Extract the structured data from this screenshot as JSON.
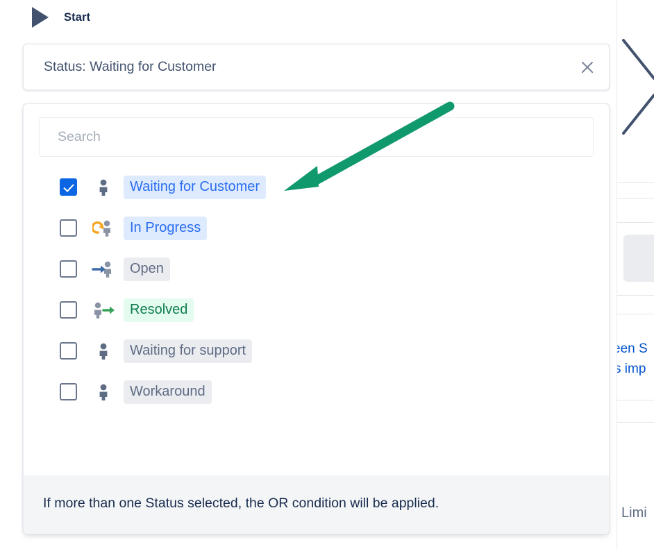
{
  "header": {
    "play_icon": "play-triangle-icon",
    "label": "Start"
  },
  "status_field": {
    "value": "Status: Waiting for Customer",
    "clear_icon": "close-x-icon"
  },
  "dropdown": {
    "search": {
      "placeholder": "Search",
      "value": ""
    },
    "options": [
      {
        "label": "Waiting for Customer",
        "checked": true,
        "icon": "person-icon",
        "label_style": "lbl-blue"
      },
      {
        "label": "In Progress",
        "checked": false,
        "icon": "person-refresh-icon",
        "label_style": "lbl-blue"
      },
      {
        "label": "Open",
        "checked": false,
        "icon": "person-arrow-in-icon",
        "label_style": "lbl-grey"
      },
      {
        "label": "Resolved",
        "checked": false,
        "icon": "person-arrow-out-icon",
        "label_style": "lbl-green"
      },
      {
        "label": "Waiting for support",
        "checked": false,
        "icon": "person-icon",
        "label_style": "lbl-grey"
      },
      {
        "label": "Workaround",
        "checked": false,
        "icon": "person-icon",
        "label_style": "lbl-grey"
      }
    ],
    "footer_note": "If more than one Status selected, the OR condition will be applied."
  },
  "background": {
    "text_fragment_line1": "een S",
    "text_fragment_line2": "s imp",
    "limit_fragment": "Limi"
  },
  "annotation": {
    "arrow_color": "#11996e",
    "points_to": "Waiting for Customer"
  },
  "colors": {
    "accent_blue": "#0c66e4",
    "label_blue_text": "#2b6ef0",
    "label_blue_bg": "#deebff",
    "label_green_text": "#0f7d4d",
    "label_green_bg": "#e3fcef",
    "label_grey_text": "#5e6c84",
    "label_grey_bg": "#ebecf0",
    "annotation_green": "#11996e",
    "text_dark": "#172b4d"
  }
}
